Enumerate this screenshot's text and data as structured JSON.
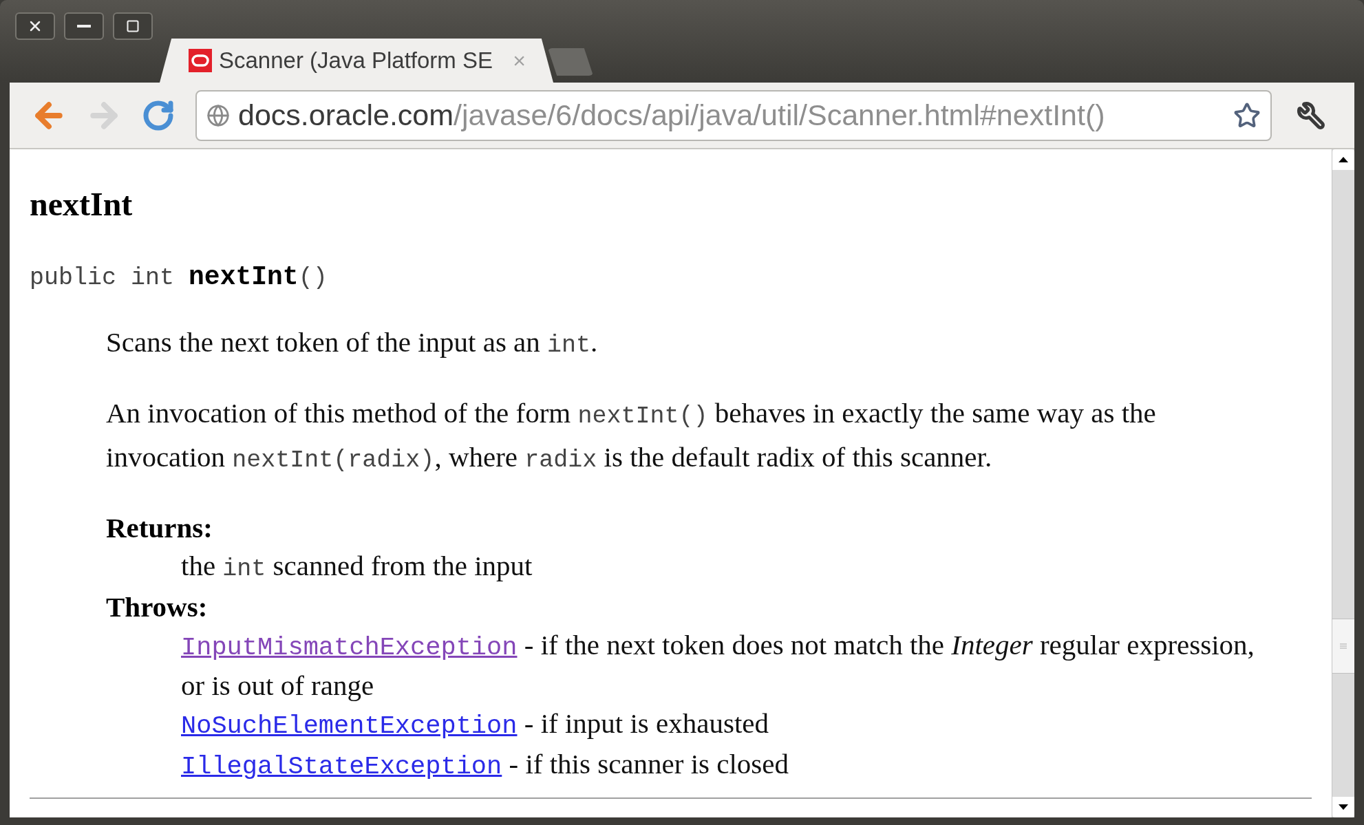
{
  "tabs": [
    {
      "title": "Scanner (Java Platform SE",
      "close": "×",
      "selected": true
    }
  ],
  "address_bar": {
    "domain": "docs.oracle.com",
    "path": "/javase/6/docs/api/java/util/Scanner.html#nextInt()"
  },
  "page": {
    "heading": "nextInt",
    "signature": [
      {
        "kind": "code",
        "text": "public int "
      },
      {
        "kind": "bold_code",
        "text": "nextInt"
      },
      {
        "kind": "code",
        "text": "()"
      }
    ],
    "paragraphs": [
      [
        {
          "kind": "text",
          "text": "Scans the next token of the input as an "
        },
        {
          "kind": "code",
          "text": "int"
        },
        {
          "kind": "text",
          "text": "."
        }
      ],
      [
        {
          "kind": "text",
          "text": "An invocation of this method of the form "
        },
        {
          "kind": "code",
          "text": "nextInt()"
        },
        {
          "kind": "text",
          "text": " behaves in exactly the same way as the invocation "
        },
        {
          "kind": "code",
          "text": "nextInt(radix)"
        },
        {
          "kind": "text",
          "text": ", where "
        },
        {
          "kind": "code",
          "text": "radix"
        },
        {
          "kind": "text",
          "text": " is the default radix of this scanner."
        }
      ]
    ],
    "returns": {
      "label": "Returns:",
      "description": [
        {
          "kind": "text",
          "text": "the "
        },
        {
          "kind": "code",
          "text": "int"
        },
        {
          "kind": "text",
          "text": " scanned from the input"
        }
      ]
    },
    "throws": {
      "label": "Throws:",
      "items": [
        {
          "link": "InputMismatchException",
          "visited": true,
          "description": " - if the next token does not match the *Integer* regular expression, or is out of range"
        },
        {
          "link": "NoSuchElementException",
          "visited": false,
          "description": " - if input is exhausted"
        },
        {
          "link": "IllegalStateException",
          "visited": false,
          "description": " - if this scanner is closed"
        }
      ]
    }
  }
}
